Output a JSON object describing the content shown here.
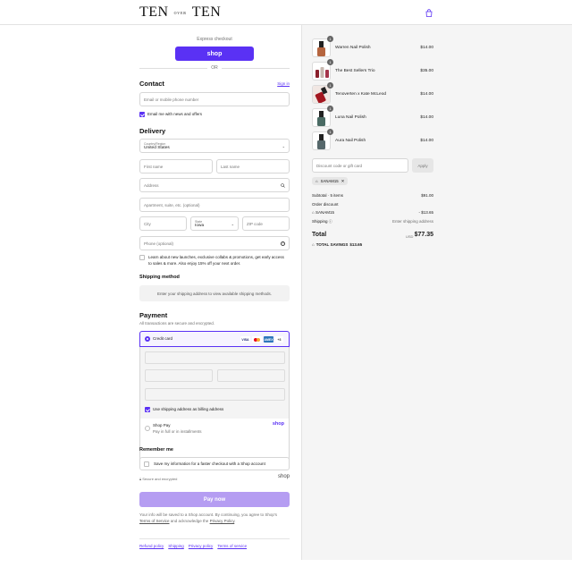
{
  "brand": {
    "logo_left": "TEN",
    "logo_mid": "OVER",
    "logo_right": "TEN"
  },
  "express": {
    "label": "Express checkout",
    "shop_button": "shop",
    "or": "OR"
  },
  "contact": {
    "title": "Contact",
    "sign_in": "Sign in",
    "email_placeholder": "Email or mobile phone number",
    "news_label": "Email me with news and offers",
    "news_checked": true
  },
  "delivery": {
    "title": "Delivery",
    "country_label": "Country/Region",
    "country_value": "United States",
    "first_name_placeholder": "First name",
    "last_name_placeholder": "Last name",
    "address_placeholder": "Address",
    "apartment_placeholder": "Apartment, suite, etc. (optional)",
    "city_placeholder": "City",
    "state_label": "State",
    "state_value": "Iowa",
    "zip_placeholder": "ZIP code",
    "phone_placeholder": "Phone (optional)",
    "text_offers_line1": "Learn about new launches, exclusive collabs & promotions, get early access",
    "text_offers_line2": "to sales & more. Also enjoy 15% off your next order."
  },
  "shipping_method": {
    "title": "Shipping method",
    "message": "Enter your shipping address to view available shipping methods."
  },
  "payment": {
    "title": "Payment",
    "subtitle": "All transactions are secure and encrypted.",
    "credit_card_label": "Credit card",
    "card_brands": [
      "VISA",
      "mastercard",
      "AMEX",
      "+3"
    ],
    "billing_same_label": "Use shipping address as billing address",
    "billing_same_checked": true,
    "shop_pay_label": "Shop Pay",
    "shop_pay_sub": "Pay in full or in installments",
    "shop_pay_logo": "shop"
  },
  "remember": {
    "title": "Remember me",
    "save_label": "Save my information for a faster checkout with a Shop account",
    "secure_label": "Secure and encrypted",
    "shop_logo": "shop"
  },
  "pay_now": "Pay now",
  "legal": {
    "line1": "Your info will be saved to a Shop account. By continuing, you agree to Shop's",
    "tos": "Terms of Service",
    "and": "and acknowledge the",
    "privacy": "Privacy Policy",
    "end": "."
  },
  "footer_links": [
    "Refund policy",
    "Shipping",
    "Privacy policy",
    "Terms of service"
  ],
  "order": {
    "items": [
      {
        "name": "Warren Nail Polish",
        "price": "$14.00",
        "qty": "1",
        "color": "#b5653f"
      },
      {
        "name": "The Best Sellers Trio",
        "price": "$35.00",
        "qty": "1",
        "color": "#8a1f2b"
      },
      {
        "name": "Tenoverten x Kate McLeod",
        "price": "$14.00",
        "qty": "1",
        "color": "#a3161f"
      },
      {
        "name": "Luna Nail Polish",
        "price": "$14.00",
        "qty": "1",
        "color": "#4a6b64"
      },
      {
        "name": "Aura Nail Polish",
        "price": "$14.00",
        "qty": "1",
        "color": "#56686b"
      }
    ],
    "discount_placeholder": "Discount code or gift card",
    "apply": "Apply",
    "applied_code": "SANAM15",
    "subtotal_label": "Subtotal · 5 items",
    "subtotal_value": "$91.00",
    "order_discount_label": "Order discount",
    "discount_code": "SANAM15",
    "discount_value": "- $13.65",
    "shipping_label": "Shipping",
    "shipping_value": "Enter shipping address",
    "total_label": "Total",
    "currency": "USD",
    "total_value": "$77.35",
    "total_savings_label": "TOTAL SAVINGS",
    "total_savings_value": "$13.65"
  },
  "colors": {
    "accent": "#5a31f4",
    "pay_now": "#b59df2",
    "panel": "#f5f5f5"
  }
}
